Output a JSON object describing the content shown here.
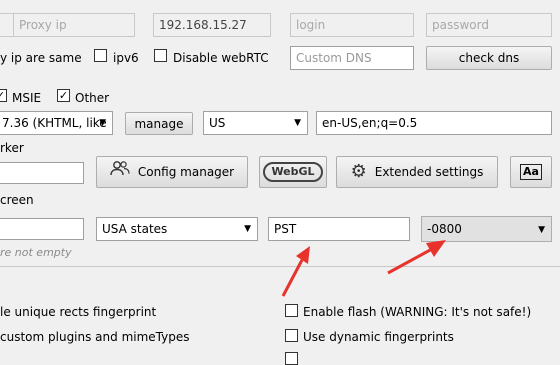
{
  "proxy": {
    "type_value": "",
    "ip_placeholder": "Proxy ip",
    "port_value": "192.168.15.27",
    "login_placeholder": "login",
    "password_placeholder": "password"
  },
  "options": {
    "ip_same_label": "y ip are same",
    "ipv6_label": "ipv6",
    "disable_webrtc_label": "Disable webRTC",
    "custom_dns_placeholder": "Custom DNS",
    "check_dns_label": "check dns"
  },
  "browsers": {
    "msie_label": "MSIE",
    "other_label": "Other"
  },
  "useragent": {
    "value": "7.36 (KHTML, like",
    "manage_label": "manage",
    "country_value": "US",
    "language_value": "en-US,en;q=0.5"
  },
  "worker": {
    "label": "rker",
    "config_manager_label": "Config manager",
    "webgl_label": "WebGL",
    "extended_settings_label": "Extended settings",
    "fonts_icon_label": "Aa"
  },
  "screen": {
    "label": "creen",
    "state_value": "USA states",
    "timezone_value": "PST",
    "offset_value": "-0800",
    "note": "re not empty"
  },
  "fingerprint": {
    "unique_rects_label": "le unique rects fingerprint",
    "custom_plugins_label": "custom plugins and mimeTypes",
    "enable_flash_label": "Enable flash (WARNING: It's not safe!)",
    "dynamic_fp_label": "Use dynamic fingerprints"
  },
  "colors": {
    "arrow": "#e8322b",
    "button_border": "#adadad"
  }
}
